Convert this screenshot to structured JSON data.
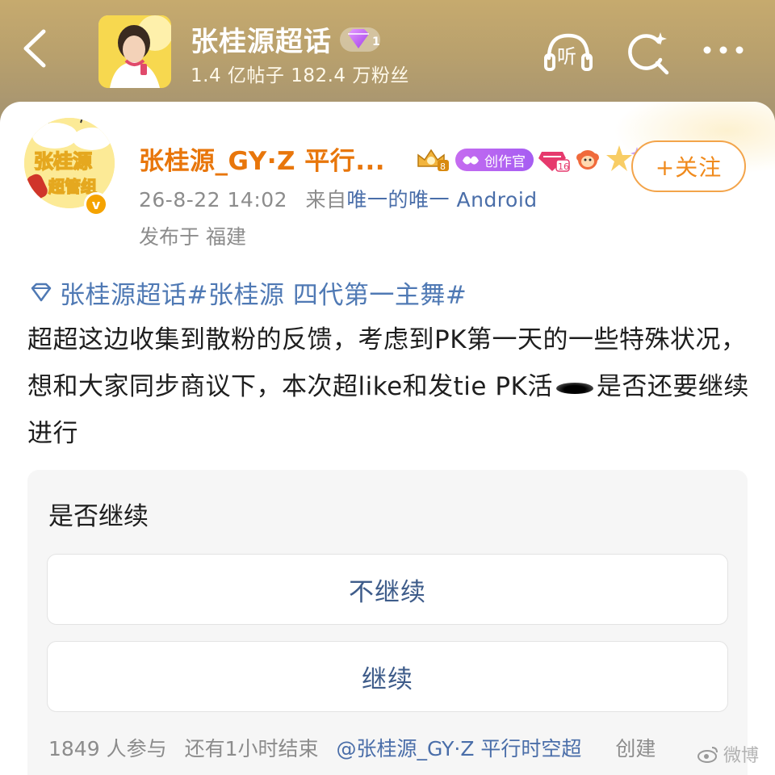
{
  "header": {
    "title": "张桂源超话",
    "stats": "1.4 亿帖子 182.4 万粉丝",
    "listen_label": "听",
    "icons": [
      "back-arrow-icon",
      "diamond-icon",
      "listen-icon",
      "search-icon",
      "more-icon"
    ]
  },
  "post": {
    "author": {
      "name": "张桂源_GY·Z 平行...",
      "avatar_text": "张桂源超管组",
      "verified_label": "v",
      "badges": {
        "level": "8",
        "creator": "创作官",
        "vip_level": "16"
      }
    },
    "follow_label": "+关注",
    "time": "26-8-22 14:02",
    "source_prefix": "来自",
    "source": "唯一的唯一 Android",
    "location": "发布于 福建",
    "topic": "张桂源超话#张桂源 四代第一主舞#",
    "text_part1": "超超这边收集到散粉的反馈，考虑到PK第一天的一些特殊状况，想和大家同步商议下，本次超like和发tie PK活",
    "text_part2": "是否还要继续进行"
  },
  "poll": {
    "title": "是否继续",
    "options": [
      {
        "label": "不继续"
      },
      {
        "label": "继续"
      }
    ],
    "participants": "1849 人参与",
    "time_left": "还有1小时结束",
    "creator": "@张桂源_GY·Z 平行时空超",
    "create_label": "创建"
  },
  "watermark": "微博",
  "colors": {
    "accent_orange": "#e8760b",
    "link_blue": "#4f79b4",
    "creator_purple": "#a65df2"
  }
}
